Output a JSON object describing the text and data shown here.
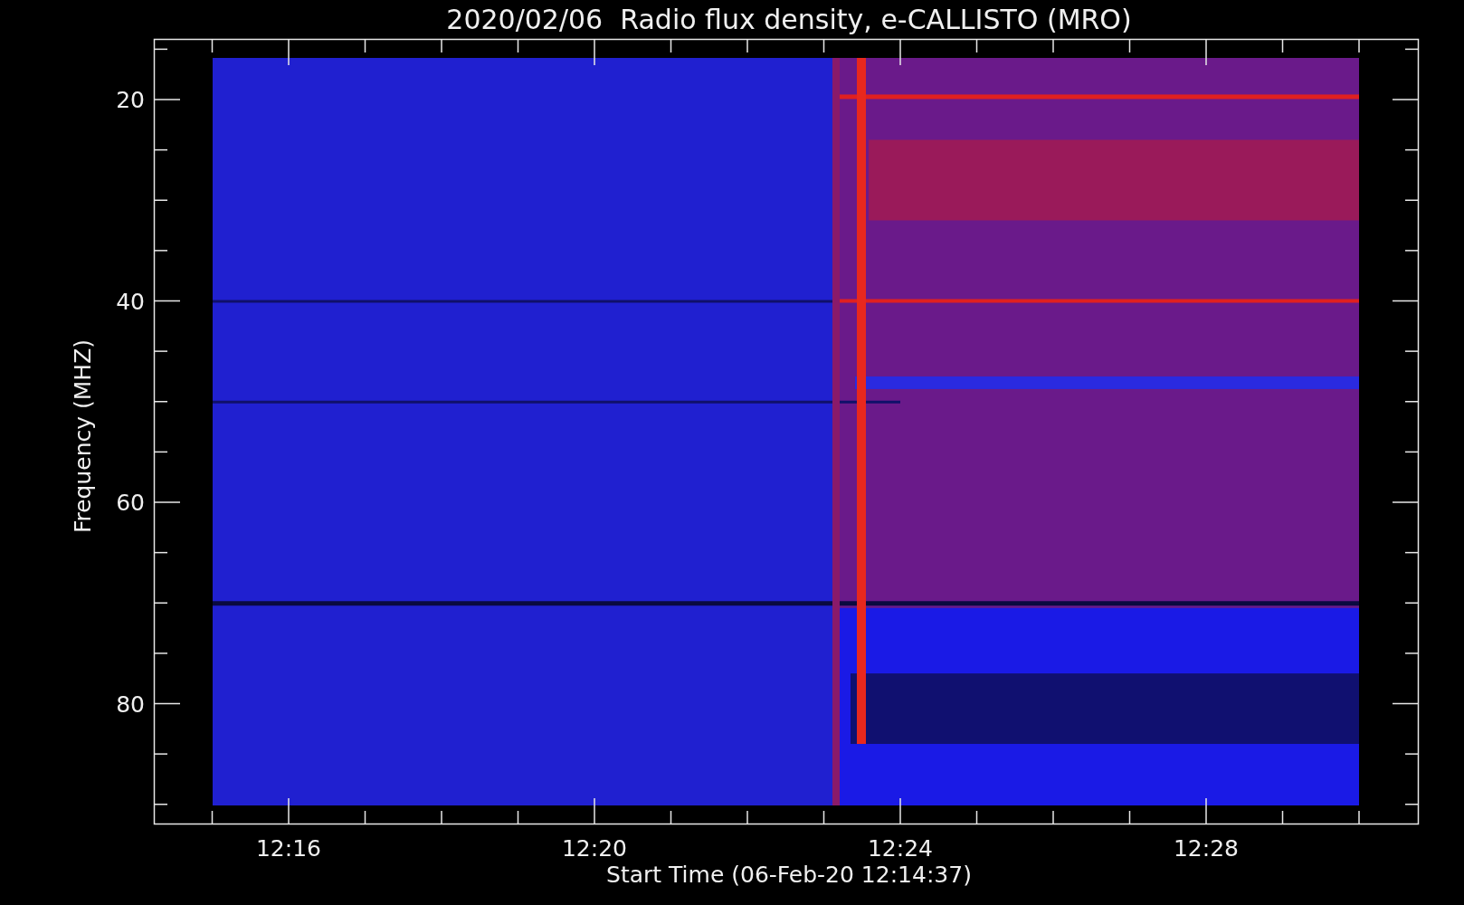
{
  "title": "2020/02/06  Radio flux density, e-CALLISTO (MRO)",
  "plot": {
    "kind": "spectrogram"
  },
  "y_axis": {
    "label": "Frequency (MHZ)",
    "ticks": [
      "20",
      "40",
      "60",
      "80"
    ]
  },
  "x_axis": {
    "label": "Start Time (06-Feb-20 12:14:37)",
    "ticks": [
      "12:16",
      "12:20",
      "12:24",
      "12:28"
    ]
  }
}
